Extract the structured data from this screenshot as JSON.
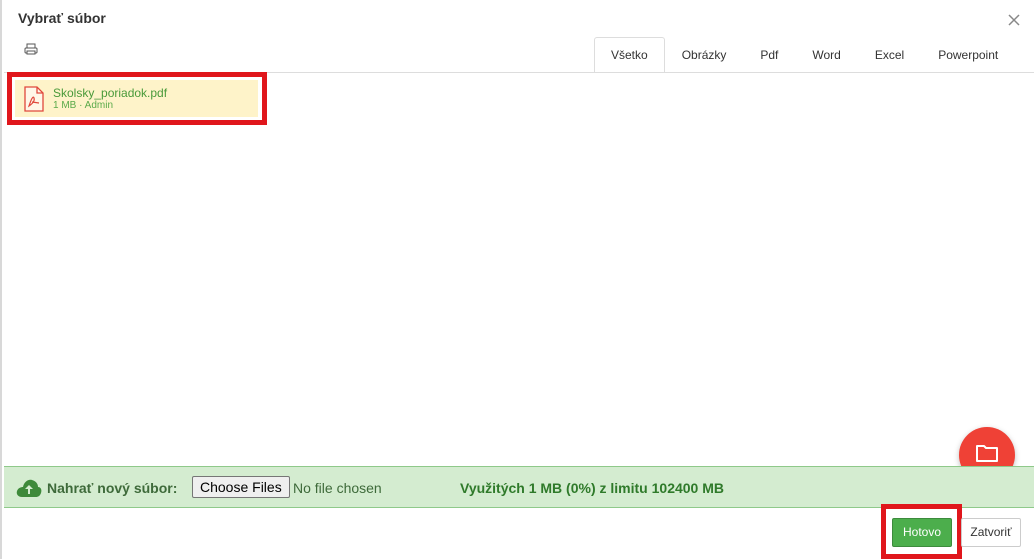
{
  "dialog": {
    "title": "Vybrať súbor"
  },
  "tabs": [
    {
      "label": "Všetko",
      "active": true
    },
    {
      "label": "Obrázky",
      "active": false
    },
    {
      "label": "Pdf",
      "active": false
    },
    {
      "label": "Word",
      "active": false
    },
    {
      "label": "Excel",
      "active": false
    },
    {
      "label": "Powerpoint",
      "active": false
    }
  ],
  "files": [
    {
      "name": "Skolsky_poriadok.pdf",
      "meta": "1 MB · Admin",
      "icon": "pdf-file-icon",
      "selected": true
    }
  ],
  "upload": {
    "label": "Nahrať nový súbor:",
    "choose_label": "Choose Files",
    "no_file_text": "No file chosen",
    "usage_text": "Využitých 1 MB (0%) z limitu 102400 MB"
  },
  "footer": {
    "done_label": "Hotovo",
    "close_label": "Zatvoriť"
  },
  "colors": {
    "accent_green": "#4cae4c",
    "fab_red": "#ef4136",
    "highlight_red": "#e0161c",
    "selected_file_bg": "#fef3c9",
    "upload_bar_bg": "#d4ecd0"
  }
}
